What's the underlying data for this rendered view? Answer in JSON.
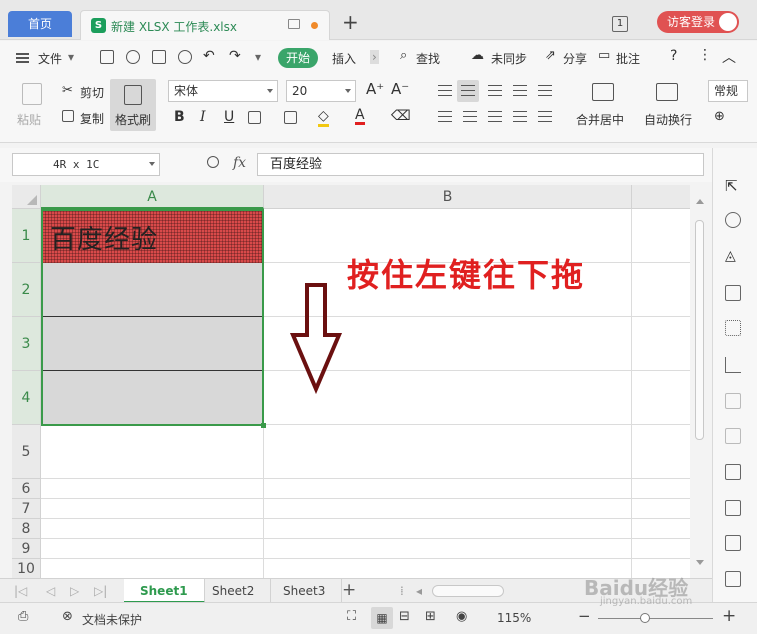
{
  "titlebar": {
    "home_tab": "首页",
    "file_tab": "新建 XLSX 工作表.xlsx",
    "file_icon": "S",
    "add_tab": "+",
    "window_count": "1",
    "login": "访客登录"
  },
  "menubar": {
    "file": "文件",
    "start": "开始",
    "insert": "插入",
    "search": "查找",
    "unsync": "未同步",
    "share": "分享",
    "review": "批注",
    "help": "?"
  },
  "ribbon": {
    "paste": "粘贴",
    "cut": "剪切",
    "copy": "复制",
    "format_brush": "格式刷",
    "font_name": "宋体",
    "font_size": "20",
    "bold": "B",
    "italic": "I",
    "underline": "U",
    "font_color": "A",
    "grow_font": "A⁺",
    "shrink_font": "A⁻",
    "merge_center": "合并居中",
    "wrap_text": "自动换行",
    "number_format": "常规"
  },
  "formula_bar": {
    "name_box": "4R x 1C",
    "fx": "fx",
    "content": "百度经验"
  },
  "sheet": {
    "columns": [
      "A",
      "B"
    ],
    "rows": [
      "1",
      "2",
      "3",
      "4",
      "5",
      "6",
      "7",
      "8",
      "9",
      "10"
    ],
    "cell_a1": "百度经验",
    "instruction": "按住左键往下拖"
  },
  "sheet_tabs": [
    "Sheet1",
    "Sheet2",
    "Sheet3"
  ],
  "statusbar": {
    "protect": "文档未保护",
    "zoom": "115%",
    "zoom_minus": "−",
    "zoom_plus": "+"
  },
  "watermark": {
    "brand": "Baidu经验",
    "url": "jingyan.baidu.com"
  },
  "colors": {
    "accent_green": "#3a9a4a",
    "instruction_red": "#e02020",
    "arrow_dark_red": "#6b1010",
    "home_tab_blue": "#4b7ed8"
  }
}
